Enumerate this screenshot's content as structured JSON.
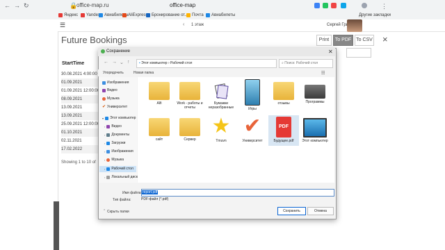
{
  "browser": {
    "address": "office-map.ru",
    "tab_title": "office-map",
    "bookmarks": [
      {
        "label": "Яндекс",
        "color": "#e53935"
      },
      {
        "label": "Yandex",
        "color": "#e53935"
      },
      {
        "label": "Авиабилеты",
        "color": "#1e88e5"
      },
      {
        "label": "AliExpress",
        "color": "#e64a19"
      },
      {
        "label": "Бронирование от...",
        "color": "#1565c0"
      },
      {
        "label": "Почта",
        "color": "#ffb300"
      },
      {
        "label": "Авиабилеты",
        "color": "#1e88e5"
      }
    ],
    "other_bookmarks": "Другие закладки"
  },
  "app": {
    "floor": "1 этаж",
    "user": "Сергей Грин"
  },
  "bookings": {
    "title": "Future Bookings",
    "buttons": {
      "print": "Print",
      "pdf": "To PDF",
      "csv": "To CSV"
    },
    "close_icon": "×",
    "column": "StartTime",
    "rows": [
      "30.08.2021 4:00:00",
      "01.09.2021",
      "01.09.2021 12:00:00",
      "08.09.2021",
      "13.09.2021",
      "13.09.2021",
      "25.09.2021 12:00:00",
      "01.10.2021",
      "02.11.2021",
      "17.02.2022"
    ],
    "showing": "Showing 1 to 10 of"
  },
  "dialog": {
    "title": "Сохранение",
    "path": [
      "Этот компьютер",
      "Рабочий стол"
    ],
    "search_placeholder": "Поиск: Рабочий стол",
    "organize": "Упорядочить",
    "new_folder": "Новая папка",
    "nav": [
      {
        "label": "Изображения",
        "icon": "images-icon",
        "color": "#3d8ee0"
      },
      {
        "label": "Видео",
        "icon": "video-icon",
        "color": "#8e44ad"
      },
      {
        "label": "Музыка",
        "icon": "music-icon",
        "color": "#e8643a"
      },
      {
        "label": "Университет",
        "icon": "check-icon",
        "color": "#d35400"
      },
      {
        "label": "Этот компьютер",
        "icon": "computer-icon",
        "color": "#1e88e5"
      },
      {
        "label": "Видео",
        "icon": "video-icon",
        "color": "#8e44ad"
      },
      {
        "label": "Документы",
        "icon": "documents-icon",
        "color": "#607d8b"
      },
      {
        "label": "Загрузки",
        "icon": "downloads-icon",
        "color": "#1e88e5"
      },
      {
        "label": "Изображения",
        "icon": "images-icon",
        "color": "#3d8ee0"
      },
      {
        "label": "Музыка",
        "icon": "music-icon",
        "color": "#e8643a"
      },
      {
        "label": "Рабочий стол",
        "icon": "desktop-icon",
        "color": "#1e88e5"
      },
      {
        "label": "Локальный диск",
        "icon": "disk-icon",
        "color": "#9e9e9e"
      }
    ],
    "files": [
      {
        "label": "Alfi",
        "type": "folder"
      },
      {
        "label": "Work - работы и отчеты",
        "type": "folder"
      },
      {
        "label": "Бумажки неразобранные",
        "type": "papers"
      },
      {
        "label": "Игры",
        "type": "tablet"
      },
      {
        "label": "отзывы",
        "type": "folder"
      },
      {
        "label": "Программы",
        "type": "drive"
      },
      {
        "label": "сайт",
        "type": "folder"
      },
      {
        "label": "Сервер",
        "type": "folder"
      },
      {
        "label": "Tmuvn",
        "type": "star"
      },
      {
        "label": "Университет",
        "type": "check"
      },
      {
        "label": "Будущее.pdf",
        "type": "pdf"
      },
      {
        "label": "Этот компьютер",
        "type": "monitor"
      }
    ],
    "filename_label": "Имя файла:",
    "filename_value": "report.pdf",
    "filetype_label": "Тип файла:",
    "filetype_value": "PDF-файл (*.pdf)",
    "hide_folders": "Скрыть папки",
    "save": "Сохранить",
    "cancel": "Отмена"
  }
}
